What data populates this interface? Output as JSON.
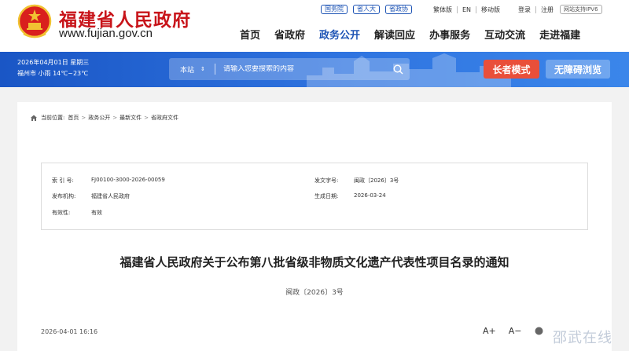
{
  "header": {
    "site_name": "福建省人民政府",
    "site_url": "www.fujian.gov.cn",
    "top_links": [
      "国务院",
      "省人大",
      "省政协"
    ],
    "utility": [
      "繁体版",
      "EN",
      "移动版",
      "登录",
      "注册"
    ],
    "ipv6": "网站支持IPV6"
  },
  "nav": {
    "items": [
      "首页",
      "省政府",
      "政务公开",
      "解读回应",
      "办事服务",
      "互动交流",
      "走进福建"
    ],
    "active_index": 2
  },
  "banner": {
    "date": "2026年04月01日 星期三",
    "weather": "福州市 小雨 14℃~23℃",
    "search_scope": "本站",
    "search_placeholder": "请输入您要搜索的内容",
    "elder_mode": "长者模式",
    "accessible": "无障碍浏览"
  },
  "breadcrumb": {
    "prefix": "当前位置:",
    "items": [
      "首页",
      "政务公开",
      "最新文件",
      "省政府文件"
    ]
  },
  "meta": {
    "index_label": "索 引 号:",
    "index_value": "FJ00100-3000-2026-00059",
    "docno_label": "发文字号:",
    "docno_value": "闽政〔2026〕3号",
    "issuer_label": "发布机构:",
    "issuer_value": "福建省人民政府",
    "date_label": "生成日期:",
    "date_value": "2026-03-24",
    "validity_label": "有效性:",
    "validity_value": "有效"
  },
  "document": {
    "title": "福建省人民政府关于公布第八批省级非物质文化遗产代表性项目名录的通知",
    "number": "闽政〔2026〕3号",
    "publish_time": "2026-04-01 16:16",
    "font_increase": "A+",
    "font_decrease": "A−"
  },
  "watermark": "邵武在线",
  "colors": {
    "brand_red": "#c8141a",
    "nav_blue": "#1e54b5",
    "banner_blue": "#2a6bdb",
    "elder_red": "#e94f3a"
  }
}
